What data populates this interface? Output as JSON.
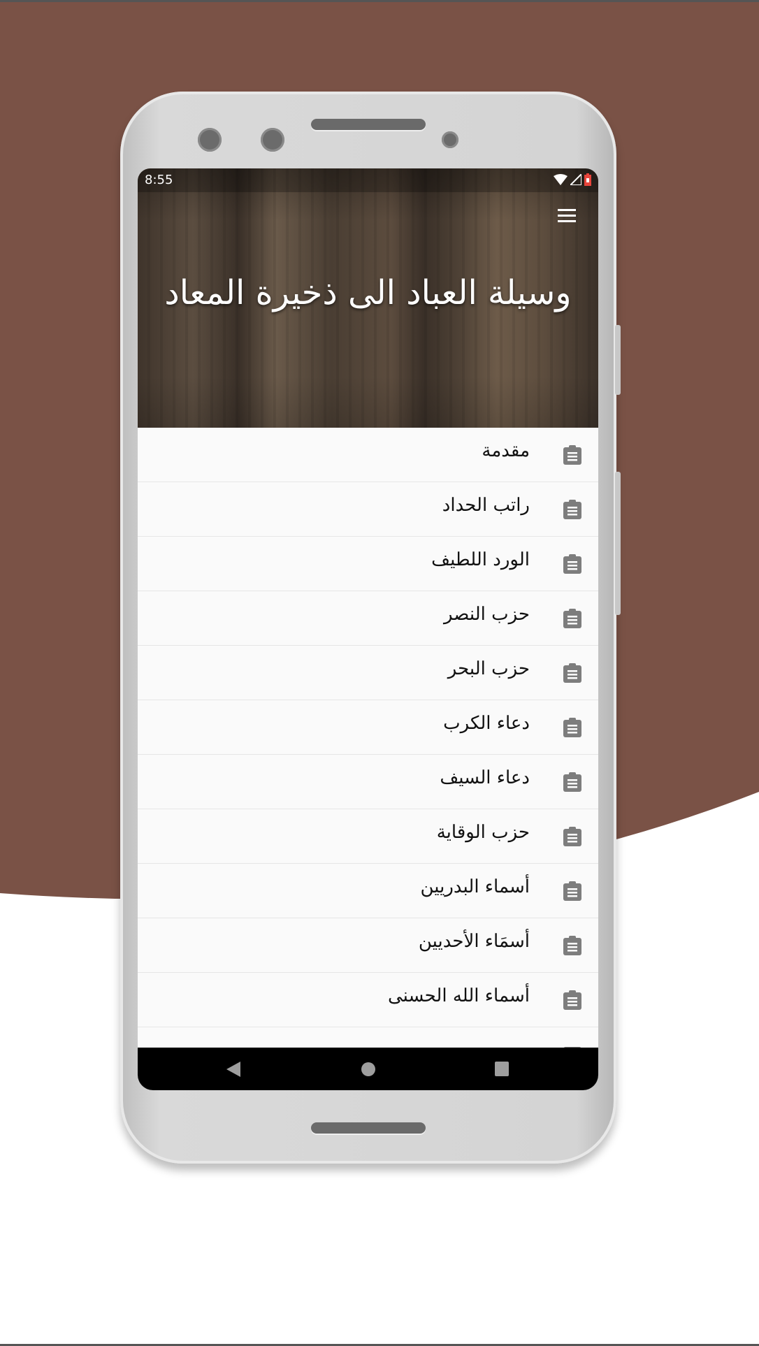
{
  "colors": {
    "background_brown": "#7a5246",
    "icon_gray": "#7d7d7d"
  },
  "status_bar": {
    "time": "8:55",
    "icons": [
      "wifi-icon",
      "signal-icon",
      "battery-icon"
    ]
  },
  "header": {
    "title": "وسيلة العباد الى ذخيرة المعاد",
    "menu_icon": "hamburger-menu-icon"
  },
  "list": {
    "items": [
      {
        "label": "مقدمة",
        "icon": "clipboard-icon"
      },
      {
        "label": "راتب الحداد",
        "icon": "clipboard-icon"
      },
      {
        "label": "الورد اللطيف",
        "icon": "clipboard-icon"
      },
      {
        "label": "حزب النصر",
        "icon": "clipboard-icon"
      },
      {
        "label": "حزب البحر",
        "icon": "clipboard-icon"
      },
      {
        "label": "دعاء الكرب",
        "icon": "clipboard-icon"
      },
      {
        "label": "دعاء السيف",
        "icon": "clipboard-icon"
      },
      {
        "label": "حزب الوقاية",
        "icon": "clipboard-icon"
      },
      {
        "label": "أسماء البدريين",
        "icon": "clipboard-icon"
      },
      {
        "label": "أسمَاء الأحديين",
        "icon": "clipboard-icon"
      },
      {
        "label": "أسماء الله الحسنى",
        "icon": "clipboard-icon"
      }
    ]
  },
  "nav_bar": {
    "buttons": [
      "back-icon",
      "home-icon",
      "recents-icon"
    ]
  }
}
